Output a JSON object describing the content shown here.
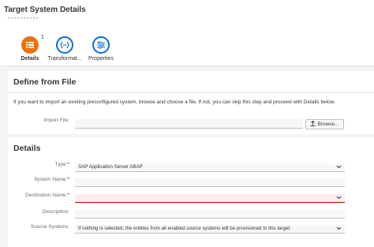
{
  "header": {
    "title": "Target System Details"
  },
  "tabs": [
    {
      "label": "Details",
      "icon": "list-icon",
      "active": true,
      "badge": "1"
    },
    {
      "label": "Transformat...",
      "icon": "transformation-icon",
      "active": false
    },
    {
      "label": "Properties",
      "icon": "properties-icon",
      "active": false
    }
  ],
  "define_file": {
    "title": "Define from File",
    "description": "If you want to import an existing preconfigured system, browse and choose a file. If not, you can skip this step and proceed with Details below.",
    "import_label": "Import File:",
    "import_value": "",
    "browse_label": "Browse..."
  },
  "details": {
    "title": "Details",
    "type_label": "Type:",
    "type_value": "SAP Application Server ABAP",
    "system_name_label": "System Name:",
    "system_name_value": "",
    "destination_label": "Destination Name:",
    "destination_value": "",
    "description_label": "Description:",
    "description_value": "",
    "source_systems_label": "Source Systems:",
    "source_systems_value": "If nothing is selected, the entities from all enabled source systems will be provisioned to this target.",
    "required_marker": "*"
  },
  "colors": {
    "accent": "#0a6ed1",
    "active_step": "#e9730c",
    "error": "#bb0000"
  }
}
